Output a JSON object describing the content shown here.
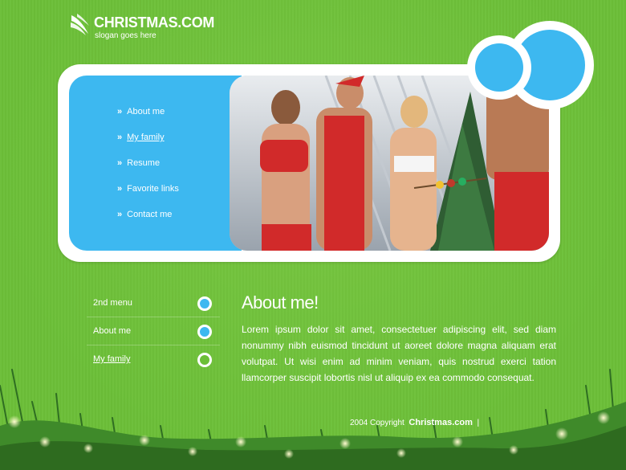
{
  "logo": {
    "name": "CHRISTMAS.COM",
    "slogan": "slogan goes here"
  },
  "main_menu": {
    "items": [
      {
        "label": "About me",
        "active": false
      },
      {
        "label": "My family",
        "active": true
      },
      {
        "label": "Resume",
        "active": false
      },
      {
        "label": "Favorite links",
        "active": false
      },
      {
        "label": "Contact me",
        "active": false
      }
    ],
    "arrow": "»"
  },
  "secondary_menu": {
    "items": [
      {
        "label": "2nd menu",
        "indicator": "dot-filled"
      },
      {
        "label": "About me",
        "indicator": "dot-filled"
      },
      {
        "label": "My family",
        "indicator": "dot-ring"
      }
    ]
  },
  "content": {
    "heading": "About me!",
    "body": "Lorem ipsum dolor sit amet, consectetuer adipiscing elit, sed diam nonummy nibh euismod tincidunt ut aoreet dolore magna aliquam erat volutpat. Ut wisi enim ad minim veniam, quis nostrud exerci tation llamcorper suscipit lobortis nisl ut aliquip ex ea commodo consequat."
  },
  "footer": {
    "copyright": "2004 Copyright",
    "site": "Christmas.com",
    "separator": "|"
  },
  "colors": {
    "background": "#6cbf38",
    "accent_blue": "#3db8f0",
    "panel": "#ffffff",
    "text": "#ffffff"
  }
}
